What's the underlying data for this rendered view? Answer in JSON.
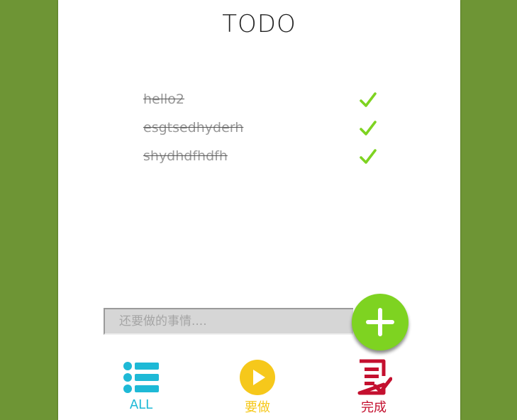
{
  "app": {
    "title": "TODO"
  },
  "tasks": [
    {
      "text": "hello2",
      "completed": true
    },
    {
      "text": "esgtsedhyderh",
      "completed": true
    },
    {
      "text": "shydhdfhdfh",
      "completed": true
    }
  ],
  "input": {
    "placeholder": "还要做的事情....",
    "value": ""
  },
  "nav": {
    "all_label": "ALL",
    "todo_label": "要做",
    "done_label": "完成"
  },
  "colors": {
    "background": "#6e9535",
    "check": "#7ed321",
    "add_button": "#7ed321",
    "all": "#1eb9d6",
    "todo": "#f6c81b",
    "done": "#c4102f"
  },
  "icons": {
    "check": "check-icon",
    "add": "plus-icon",
    "all": "list-icon",
    "todo": "play-icon",
    "done": "document-check-icon"
  }
}
